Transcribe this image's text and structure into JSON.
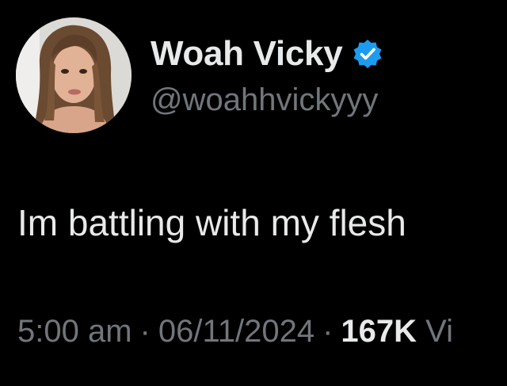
{
  "author": {
    "display_name": "Woah Vicky",
    "handle": "@woahhvickyyy",
    "verified": true,
    "avatar_icon": "profile-photo"
  },
  "tweet": {
    "text": "Im battling with my flesh",
    "time": "5:00 am",
    "date": "06/11/2024",
    "separator": "·",
    "views_count": "167K",
    "views_label": "Vi"
  },
  "colors": {
    "background": "#000000",
    "primary_text": "#e7e9ea",
    "secondary_text": "#71767b",
    "verified_blue": "#1d9bf0"
  }
}
